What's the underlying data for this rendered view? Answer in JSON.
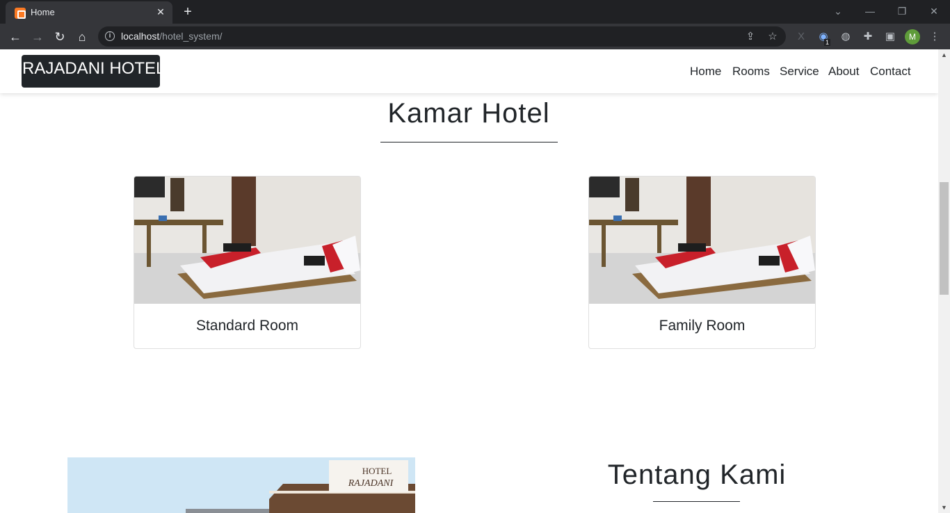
{
  "browser": {
    "tab_title": "Home",
    "tab_close": "✕",
    "new_tab": "+",
    "url_host": "localhost",
    "url_path": "/hotel_system/",
    "extension_badge": "1",
    "profile_initial": "M"
  },
  "site": {
    "brand": "RAJADANI HOTEL",
    "menu": [
      "Home",
      "Rooms",
      "Service",
      "About",
      "Contact"
    ]
  },
  "rooms_section": {
    "title": "Kamar Hotel",
    "rooms": [
      {
        "name": "Standard Room"
      },
      {
        "name": "Family Room"
      }
    ]
  },
  "about_section": {
    "title": "Tentang Kami",
    "sign_line1": "HOTEL",
    "sign_line2": "RAJADANI"
  },
  "colors": {
    "brand_bg": "#212529",
    "text": "#212529",
    "chrome_dark": "#202124",
    "chrome_toolbar": "#35363a"
  }
}
